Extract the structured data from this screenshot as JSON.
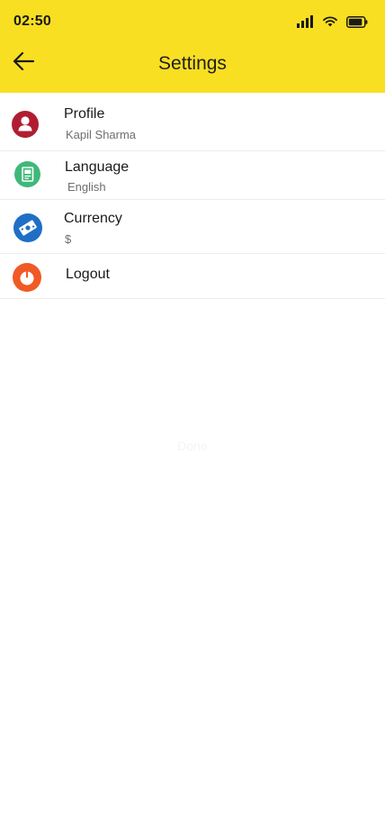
{
  "status_bar": {
    "time": "02:50"
  },
  "header": {
    "title": "Settings",
    "background_color": "#f9df22",
    "back_icon": "arrow-left-icon"
  },
  "settings": [
    {
      "id": "profile",
      "title": "Profile",
      "subtitle": "Kapil Sharma",
      "icon": "user-icon",
      "icon_color": "#b01d32"
    },
    {
      "id": "language",
      "title": "Language",
      "subtitle": "English",
      "icon": "language-document-icon",
      "icon_color": "#3fb87a"
    },
    {
      "id": "currency",
      "title": "Currency",
      "subtitle": "$",
      "icon": "currency-note-icon",
      "icon_color": "#1f6fc6"
    },
    {
      "id": "logout",
      "title": "Logout",
      "icon": "power-icon",
      "icon_color": "#f05a24"
    }
  ],
  "watermark": "Done"
}
